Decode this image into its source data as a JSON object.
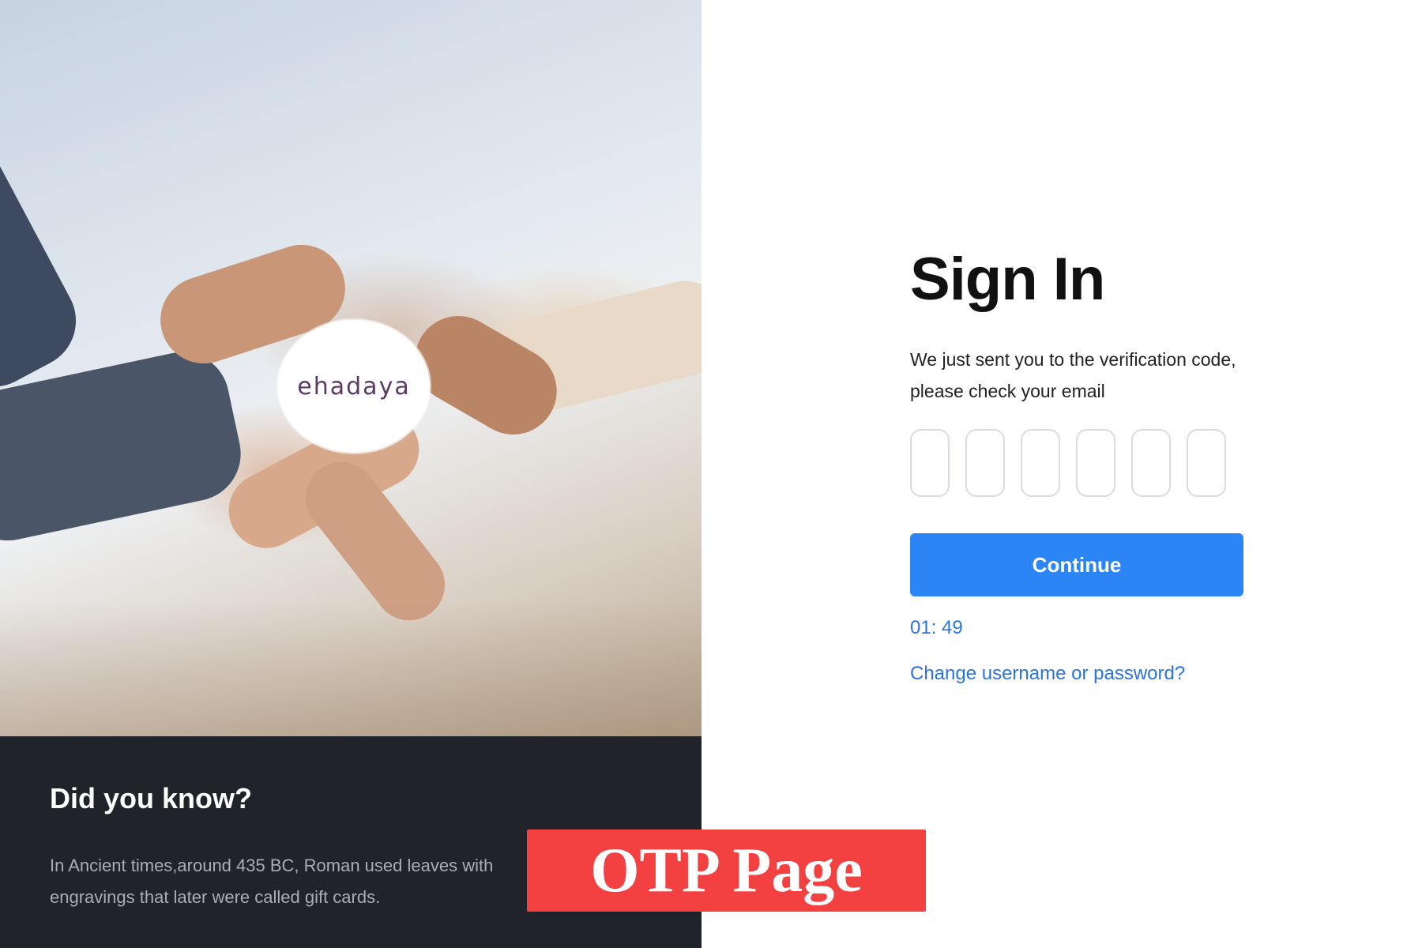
{
  "brand": {
    "logo_text": "ehadaya"
  },
  "info_panel": {
    "title": "Did you know?",
    "text": "In Ancient times,around 435 BC, Roman used leaves with engravings that later were called gift cards."
  },
  "signin": {
    "title": "Sign In",
    "subtitle_line1": "We just sent you to the verification code,",
    "subtitle_line2": "please check your email",
    "otp_digits": [
      "",
      "",
      "",
      "",
      "",
      ""
    ],
    "continue_label": "Continue",
    "timer": "01: 49",
    "change_link": "Change username or password?"
  },
  "banner": {
    "label": "OTP Page"
  },
  "colors": {
    "primary": "#2b85f5",
    "link": "#2b73e0",
    "banner": "#f34040",
    "info_bg": "#20232a"
  }
}
